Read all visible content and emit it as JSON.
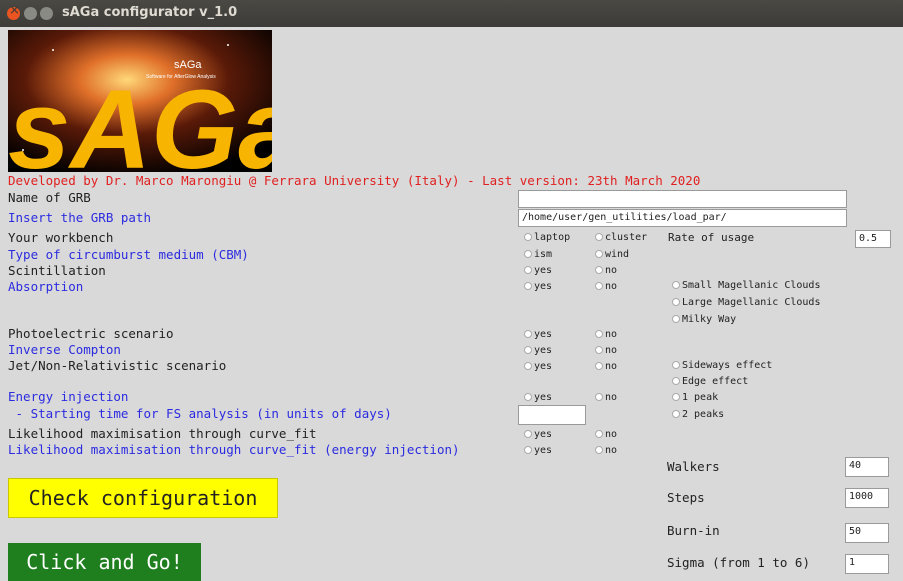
{
  "window": {
    "title": "sAGa configurator v_1.0"
  },
  "logo": {
    "big_text": "sAGa",
    "small_title": "sAGa",
    "tagline": "Software for AfterGlow Analysis"
  },
  "credit": "Developed by Dr. Marco Marongiu @ Ferrara University (Italy) - Last version: 23th March 2020",
  "labels": {
    "grb_name": "Name of GRB",
    "grb_path": "Insert the GRB path",
    "workbench": "Your workbench",
    "cbm": "Type of circumburst medium (CBM)",
    "scintillation": "Scintillation",
    "absorption": "Absorption",
    "photoelectric": "Photoelectric scenario",
    "inverse_compton": "Inverse Compton",
    "jet": "Jet/Non-Relativistic scenario",
    "energy_injection": "Energy injection",
    "starting_time": " - Starting time for FS analysis (in units of days)",
    "likelihood": "Likelihood maximisation through curve_fit",
    "likelihood_ei": "Likelihood maximisation through curve_fit (energy injection)"
  },
  "inputs": {
    "grb_name": "",
    "grb_path": "/home/user/gen_utilities/load_par/",
    "rate_of_usage": "0.5",
    "starting_time": ""
  },
  "radios": {
    "laptop": "laptop",
    "cluster": "cluster",
    "rate_label": "Rate of usage",
    "ism": "ism",
    "wind": "wind",
    "yes": "yes",
    "no": "no",
    "smc": "Small Magellanic Clouds",
    "lmc": "Large Magellanic Clouds",
    "mw": "Milky Way",
    "sideways": "Sideways effect",
    "edge": "Edge effect",
    "peak1": "1 peak",
    "peak2": "2 peaks"
  },
  "fit": {
    "walkers_label": "Walkers",
    "walkers": "40",
    "steps_label": "Steps",
    "steps": "1000",
    "burnin_label": "Burn-in",
    "burnin": "50",
    "sigma_label": "Sigma (from 1 to 6)",
    "sigma": "1"
  },
  "buttons": {
    "check": "Check configuration",
    "go": "Click and Go!"
  }
}
